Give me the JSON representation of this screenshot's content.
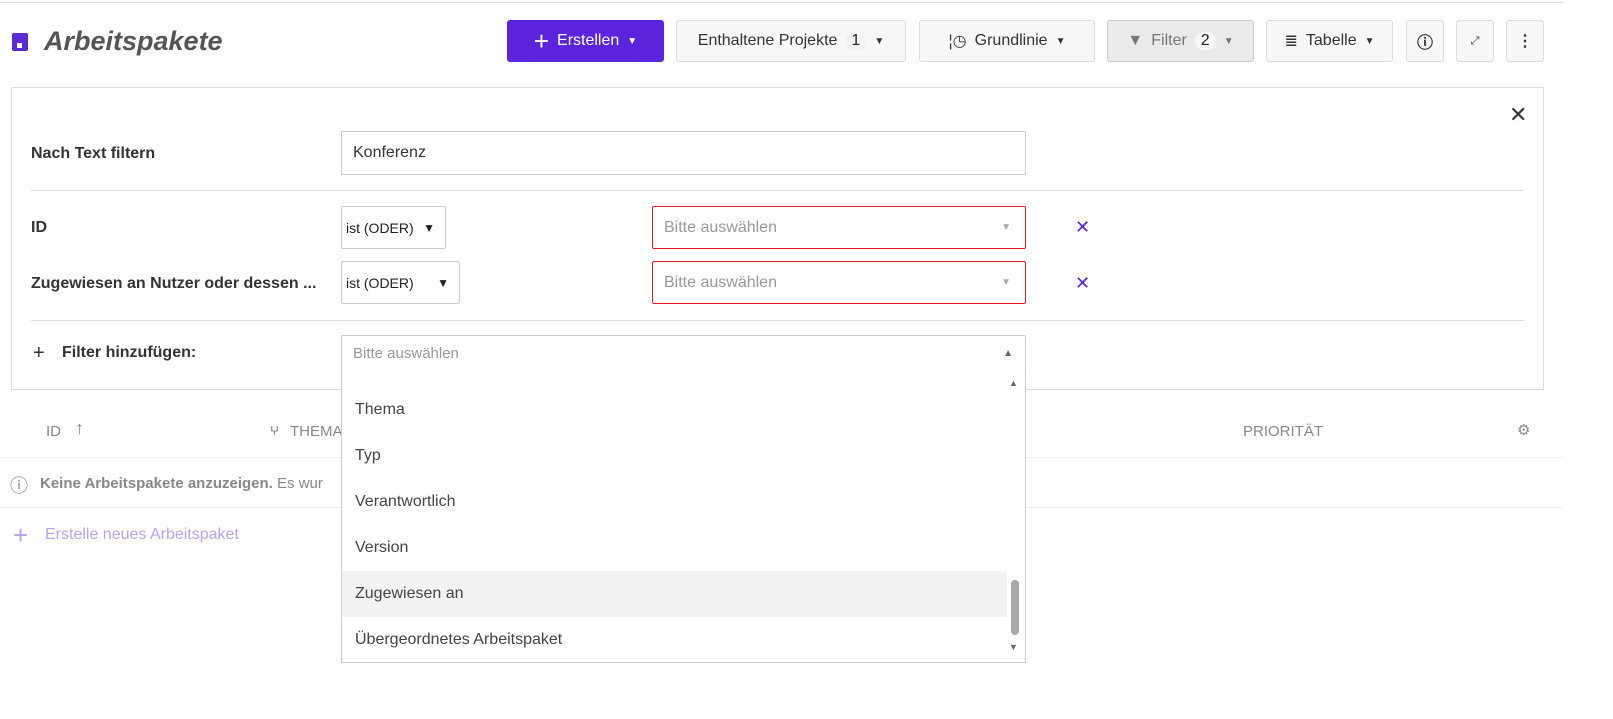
{
  "header": {
    "title": "Arbeitspakete",
    "create": "Erstellen",
    "projects": "Enthaltene Projekte",
    "projects_count": "1",
    "baseline": "Grundlinie",
    "filter": "Filter",
    "filter_count": "2",
    "view": "Tabelle"
  },
  "filters": {
    "text_label": "Nach Text filtern",
    "text_value": "Konferenz",
    "rows": [
      {
        "label": "ID",
        "operator": "ist (ODER)",
        "placeholder": "Bitte auswählen"
      },
      {
        "label": "Zugewiesen an Nutzer oder dessen ...",
        "operator": "ist (ODER)",
        "placeholder": "Bitte auswählen"
      }
    ],
    "add_label": "Filter hinzufügen:",
    "add_placeholder": "Bitte auswählen",
    "options": [
      "Thema",
      "Typ",
      "Verantwortlich",
      "Version",
      "Zugewiesen an",
      "Übergeordnetes Arbeitspaket"
    ],
    "highlighted": "Zugewiesen an"
  },
  "table": {
    "columns": [
      "ID",
      "THEMA",
      "PRIORITÄT"
    ],
    "empty_bold": "Keine Arbeitspakete anzuzeigen.",
    "empty_rest": "Es wur",
    "create_link": "Erstelle neues Arbeitspaket"
  }
}
